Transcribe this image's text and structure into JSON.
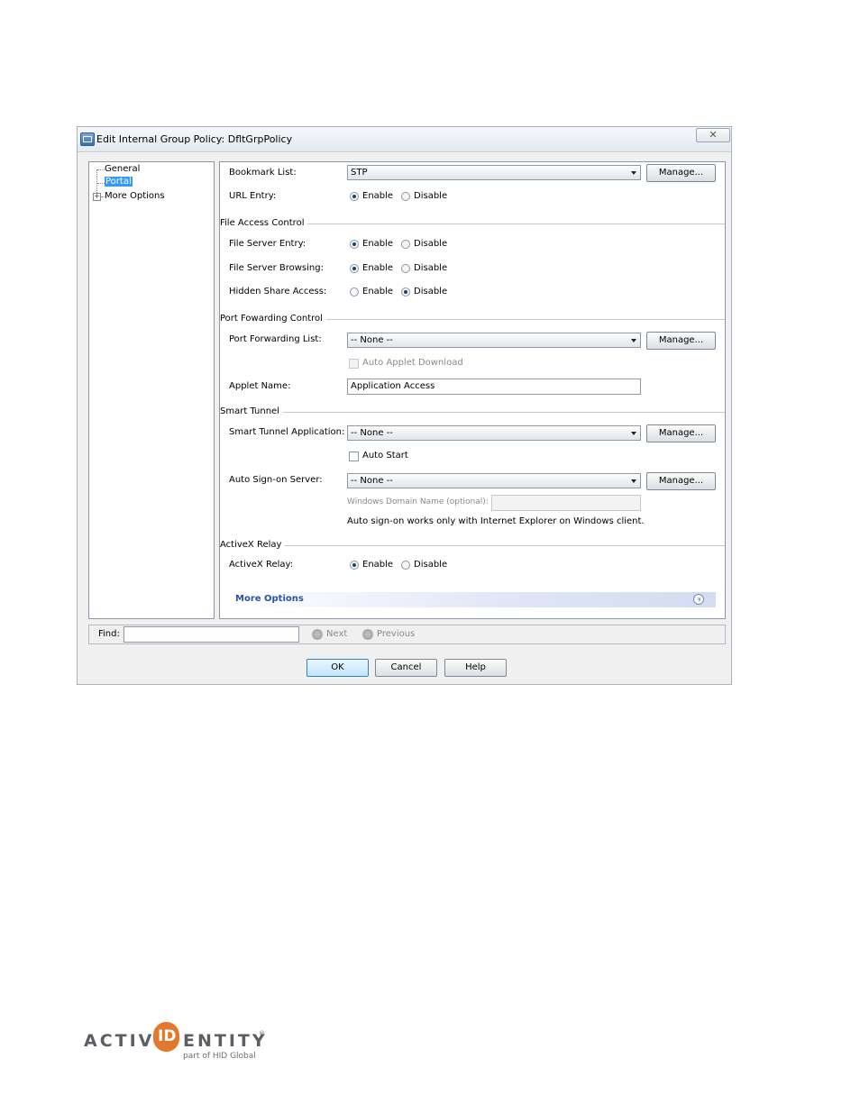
{
  "dialog": {
    "title": "Edit Internal Group Policy: DfltGrpPolicy",
    "close_symbol": "✕"
  },
  "tree": {
    "items": [
      {
        "label": "General"
      },
      {
        "label": "Portal",
        "selected": true
      },
      {
        "label": "More Options",
        "expander": "+"
      }
    ]
  },
  "panel": {
    "bookmark": {
      "label": "Bookmark List:",
      "value": "STP",
      "manage": "Manage..."
    },
    "url_entry": {
      "label": "URL Entry:",
      "enable": "Enable",
      "disable": "Disable",
      "selected": "Enable"
    },
    "file_access": {
      "section": "File Access Control",
      "server_entry": {
        "label": "File Server Entry:",
        "enable": "Enable",
        "disable": "Disable",
        "selected": "Enable"
      },
      "server_browsing": {
        "label": "File Server Browsing:",
        "enable": "Enable",
        "disable": "Disable",
        "selected": "Enable"
      },
      "hidden_share": {
        "label": "Hidden Share Access:",
        "enable": "Enable",
        "disable": "Disable",
        "selected": "Disable"
      }
    },
    "port_forwarding": {
      "section": "Port Fowarding Control",
      "list_label": "Port Forwarding List:",
      "list_value": "-- None --",
      "manage": "Manage...",
      "auto_applet": "Auto Applet Download",
      "applet_label": "Applet Name:",
      "applet_value": "Application Access"
    },
    "smart_tunnel": {
      "section": "Smart Tunnel",
      "app_label": "Smart Tunnel Application:",
      "app_value": "-- None --",
      "manage": "Manage...",
      "auto_start": "Auto Start",
      "signon_label": "Auto Sign-on Server:",
      "signon_value": "-- None --",
      "signon_manage": "Manage...",
      "domain_label": "Windows Domain Name (optional):",
      "domain_value": "",
      "note": "Auto sign-on works only with Internet Explorer on Windows client."
    },
    "activex": {
      "section": "ActiveX Relay",
      "label": "ActiveX Relay:",
      "enable": "Enable",
      "disable": "Disable",
      "selected": "Enable"
    },
    "more_options": {
      "label": "More Options",
      "chevron": "»"
    }
  },
  "find": {
    "label": "Find:",
    "value": "",
    "next": "Next",
    "previous": "Previous"
  },
  "buttons": {
    "ok": "OK",
    "cancel": "Cancel",
    "help": "Help"
  },
  "logo": {
    "left": "ACTIV",
    "id": "ID",
    "right": "ENTITY",
    "tm": "®",
    "tagline": "part of HID Global"
  },
  "colors": {
    "selection": "#3399ff",
    "logo_orange": "#e2782b",
    "more_options_text": "#2a52a8"
  }
}
